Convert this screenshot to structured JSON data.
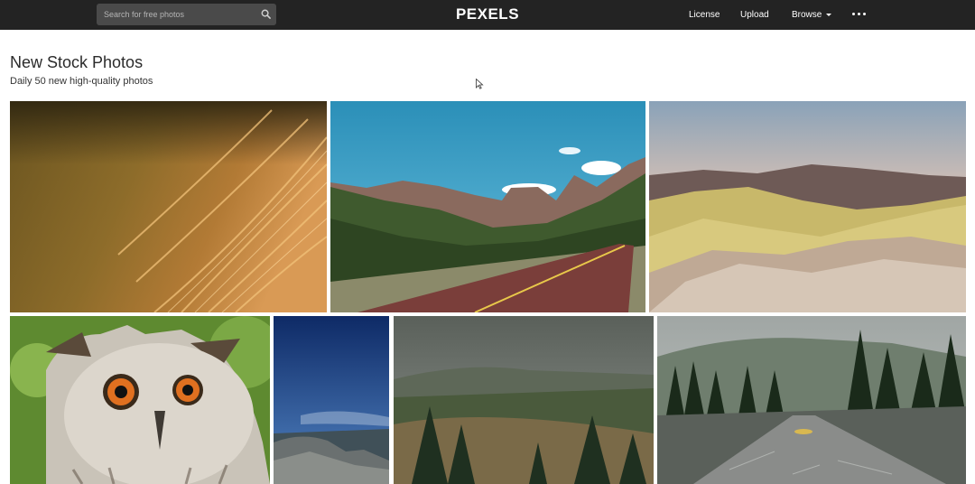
{
  "header": {
    "search": {
      "placeholder": "Search for free photos",
      "icon": "search-icon"
    },
    "logo": "PEXELS",
    "nav": {
      "license": "License",
      "upload": "Upload",
      "browse": "Browse",
      "more_icon": "more-dots-icon"
    }
  },
  "main": {
    "title": "New Stock Photos",
    "subtitle": "Daily 50 new high-quality photos"
  },
  "photos": {
    "row1": [
      {
        "subject": "golden-grass-closeup"
      },
      {
        "subject": "canyon-road"
      },
      {
        "subject": "badlands-hills"
      }
    ],
    "row2": [
      {
        "subject": "owl-portrait"
      },
      {
        "subject": "evening-sky-rocks"
      },
      {
        "subject": "misty-forest-hill"
      },
      {
        "subject": "wet-road-forest"
      }
    ]
  },
  "colors": {
    "topbar": "#232323",
    "search_bg": "#4a4a4a",
    "page_bg": "#ffffff"
  }
}
